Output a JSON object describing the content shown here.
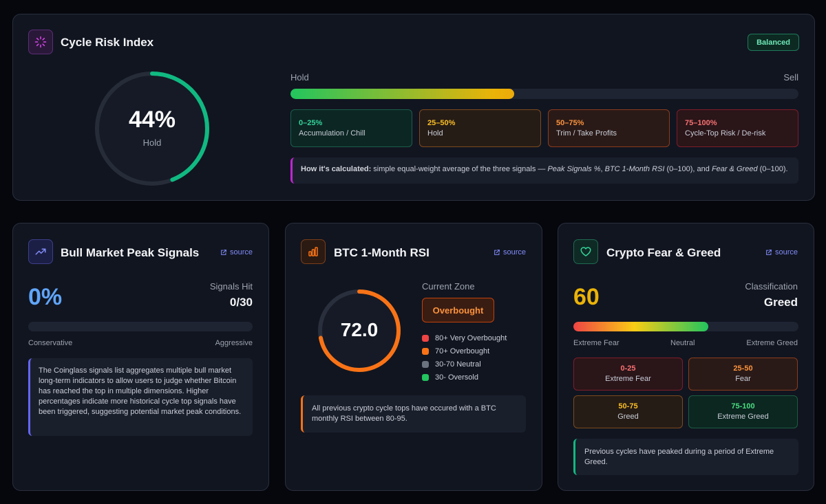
{
  "cycle_risk": {
    "title": "Cycle Risk Index",
    "badge": "Balanced",
    "value_text": "44%",
    "value": 44,
    "status": "Hold",
    "scale_left": "Hold",
    "scale_right": "Sell",
    "zones": [
      {
        "range": "0–25%",
        "label": "Accumulation / Chill"
      },
      {
        "range": "25–50%",
        "label": "Hold"
      },
      {
        "range": "50–75%",
        "label": "Trim / Take Profits"
      },
      {
        "range": "75–100%",
        "label": "Cycle-Top Risk / De-risk"
      }
    ],
    "calc_label": "How it's calculated:",
    "calc_text_1": " simple equal-weight average of the three signals — ",
    "calc_em_1": "Peak Signals %",
    "calc_text_2": ", ",
    "calc_em_2": "BTC 1-Month RSI",
    "calc_text_3": " (0–100), and ",
    "calc_em_3": "Fear & Greed",
    "calc_text_4": " (0–100)."
  },
  "peak_signals": {
    "title": "Bull Market Peak Signals",
    "source": "source",
    "value_text": "0%",
    "value": 0,
    "hit_label": "Signals Hit",
    "hit_value": "0/30",
    "scale_left": "Conservative",
    "scale_right": "Aggressive",
    "note": "The Coinglass signals list aggregates multiple bull market long-term indicators to allow users to judge whether Bitcoin has reached the top in multiple dimensions. Higher percentages indicate more historical cycle top signals have been triggered, suggesting potential market peak conditions."
  },
  "rsi": {
    "title": "BTC 1-Month RSI",
    "source": "source",
    "value_text": "72.0",
    "value": 72,
    "zone_label": "Current Zone",
    "zone_value": "Overbought",
    "legend": [
      {
        "label": "80+ Very Overbought",
        "color": "#ef4444"
      },
      {
        "label": "70+ Overbought",
        "color": "#f97316"
      },
      {
        "label": "30-70 Neutral",
        "color": "#6b7280"
      },
      {
        "label": "30- Oversold",
        "color": "#22c55e"
      }
    ],
    "note": "All previous crypto cycle tops have occured with a BTC monthly RSI between 80-95."
  },
  "fear_greed": {
    "title": "Crypto Fear & Greed",
    "source": "source",
    "value_text": "60",
    "value": 60,
    "class_label": "Classification",
    "class_value": "Greed",
    "scale_left": "Extreme Fear",
    "scale_mid": "Neutral",
    "scale_right": "Extreme Greed",
    "zones": [
      {
        "range": "0-25",
        "label": "Extreme Fear"
      },
      {
        "range": "25-50",
        "label": "Fear"
      },
      {
        "range": "50-75",
        "label": "Greed"
      },
      {
        "range": "75-100",
        "label": "Extreme Greed"
      }
    ],
    "note": "Previous cycles have peaked during a period of Extreme Greed."
  },
  "colors": {
    "risk_ring": "#10b981",
    "rsi_ring": "#f97316",
    "peak_value": "#60a5fa",
    "fg_value": "#eab308"
  },
  "icons": {
    "cycle_risk": "loader-icon",
    "peak_signals": "trending-up-icon",
    "rsi": "bar-chart-icon",
    "fear_greed": "heart-icon",
    "source": "external-link-icon"
  }
}
